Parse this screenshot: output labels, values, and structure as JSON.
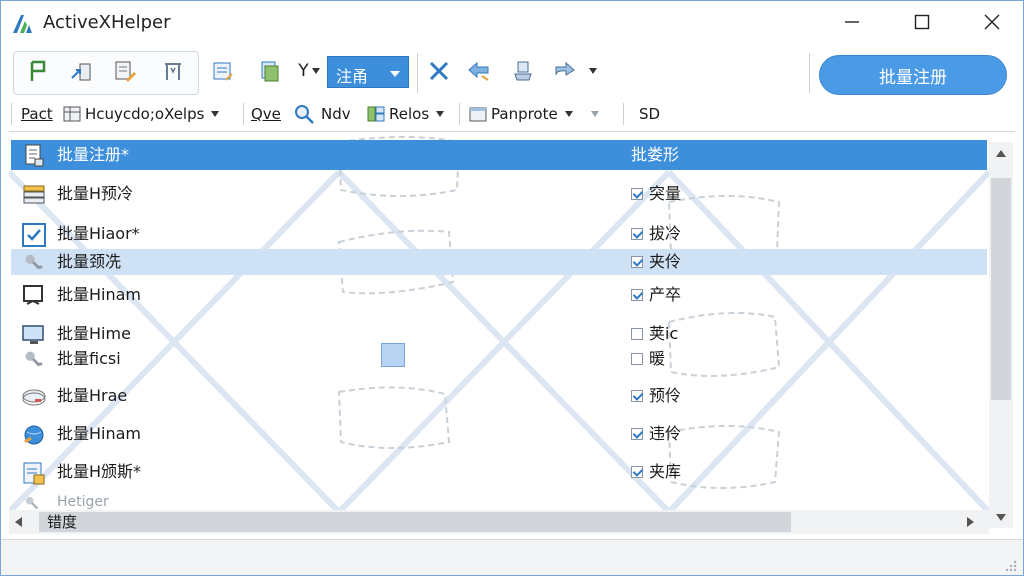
{
  "app": {
    "title": "ActiveXHelper"
  },
  "window_controls": {
    "minimize": "minimize-icon",
    "maximize": "maximize-icon",
    "close": "close-icon"
  },
  "toolbar": {
    "combo_value": "注甬",
    "primary_button": "批量注册",
    "accent_color": "#3d8fdc",
    "buttons_row1": [
      "flag-icon",
      "export-icon",
      "edit-icon",
      "gate-icon",
      "list-edit-icon",
      "copy-icon",
      "filter-icon",
      "delete-icon",
      "back-icon",
      "pin-icon",
      "forward-icon"
    ],
    "filter_label": "Y"
  },
  "toolbar2": {
    "items": [
      {
        "label": "Pact",
        "dropdown": false
      },
      {
        "label": "Hcuycdo;oXelps",
        "dropdown": true
      },
      {
        "label": "Qve",
        "dropdown": false
      },
      {
        "label": "Ndv",
        "dropdown": false
      },
      {
        "label": "Relos",
        "dropdown": true
      },
      {
        "label": "Panprote",
        "dropdown": true
      },
      {
        "label": "SD",
        "dropdown": false
      }
    ]
  },
  "list": {
    "header": {
      "name": "批量注册*",
      "status": "批娄形"
    },
    "rows": [
      {
        "name": "批量H预冷",
        "status": "突量",
        "checked": true,
        "icon": "stack-icon"
      },
      {
        "name": "批量Hiaor*",
        "status": "拔冷",
        "checked": true,
        "icon": "checkbox-icon"
      },
      {
        "name": "批量颈冼",
        "status": "夹伶",
        "checked": true,
        "icon": "plug-icon"
      },
      {
        "name": "批量Hinam",
        "status": "产卒",
        "checked": true,
        "icon": "monitor-icon"
      },
      {
        "name": "批量Hime",
        "status": "荚ic",
        "checked": false,
        "icon": "screen-icon"
      },
      {
        "name": "批量ficsi",
        "status": "暖",
        "checked": false,
        "icon": "plug-icon"
      },
      {
        "name": "批量Hrae",
        "status": "预伶",
        "checked": true,
        "icon": "drive-icon"
      },
      {
        "name": "批量Hinam",
        "status": "违伶",
        "checked": true,
        "icon": "globe-icon"
      },
      {
        "name": "批量H颁斯*",
        "status": "夹库",
        "checked": true,
        "icon": "document-icon"
      },
      {
        "name": "Hetiger",
        "status": "",
        "checked": false,
        "icon": "plug-icon"
      }
    ]
  },
  "hscroll": {
    "label": "错度"
  }
}
